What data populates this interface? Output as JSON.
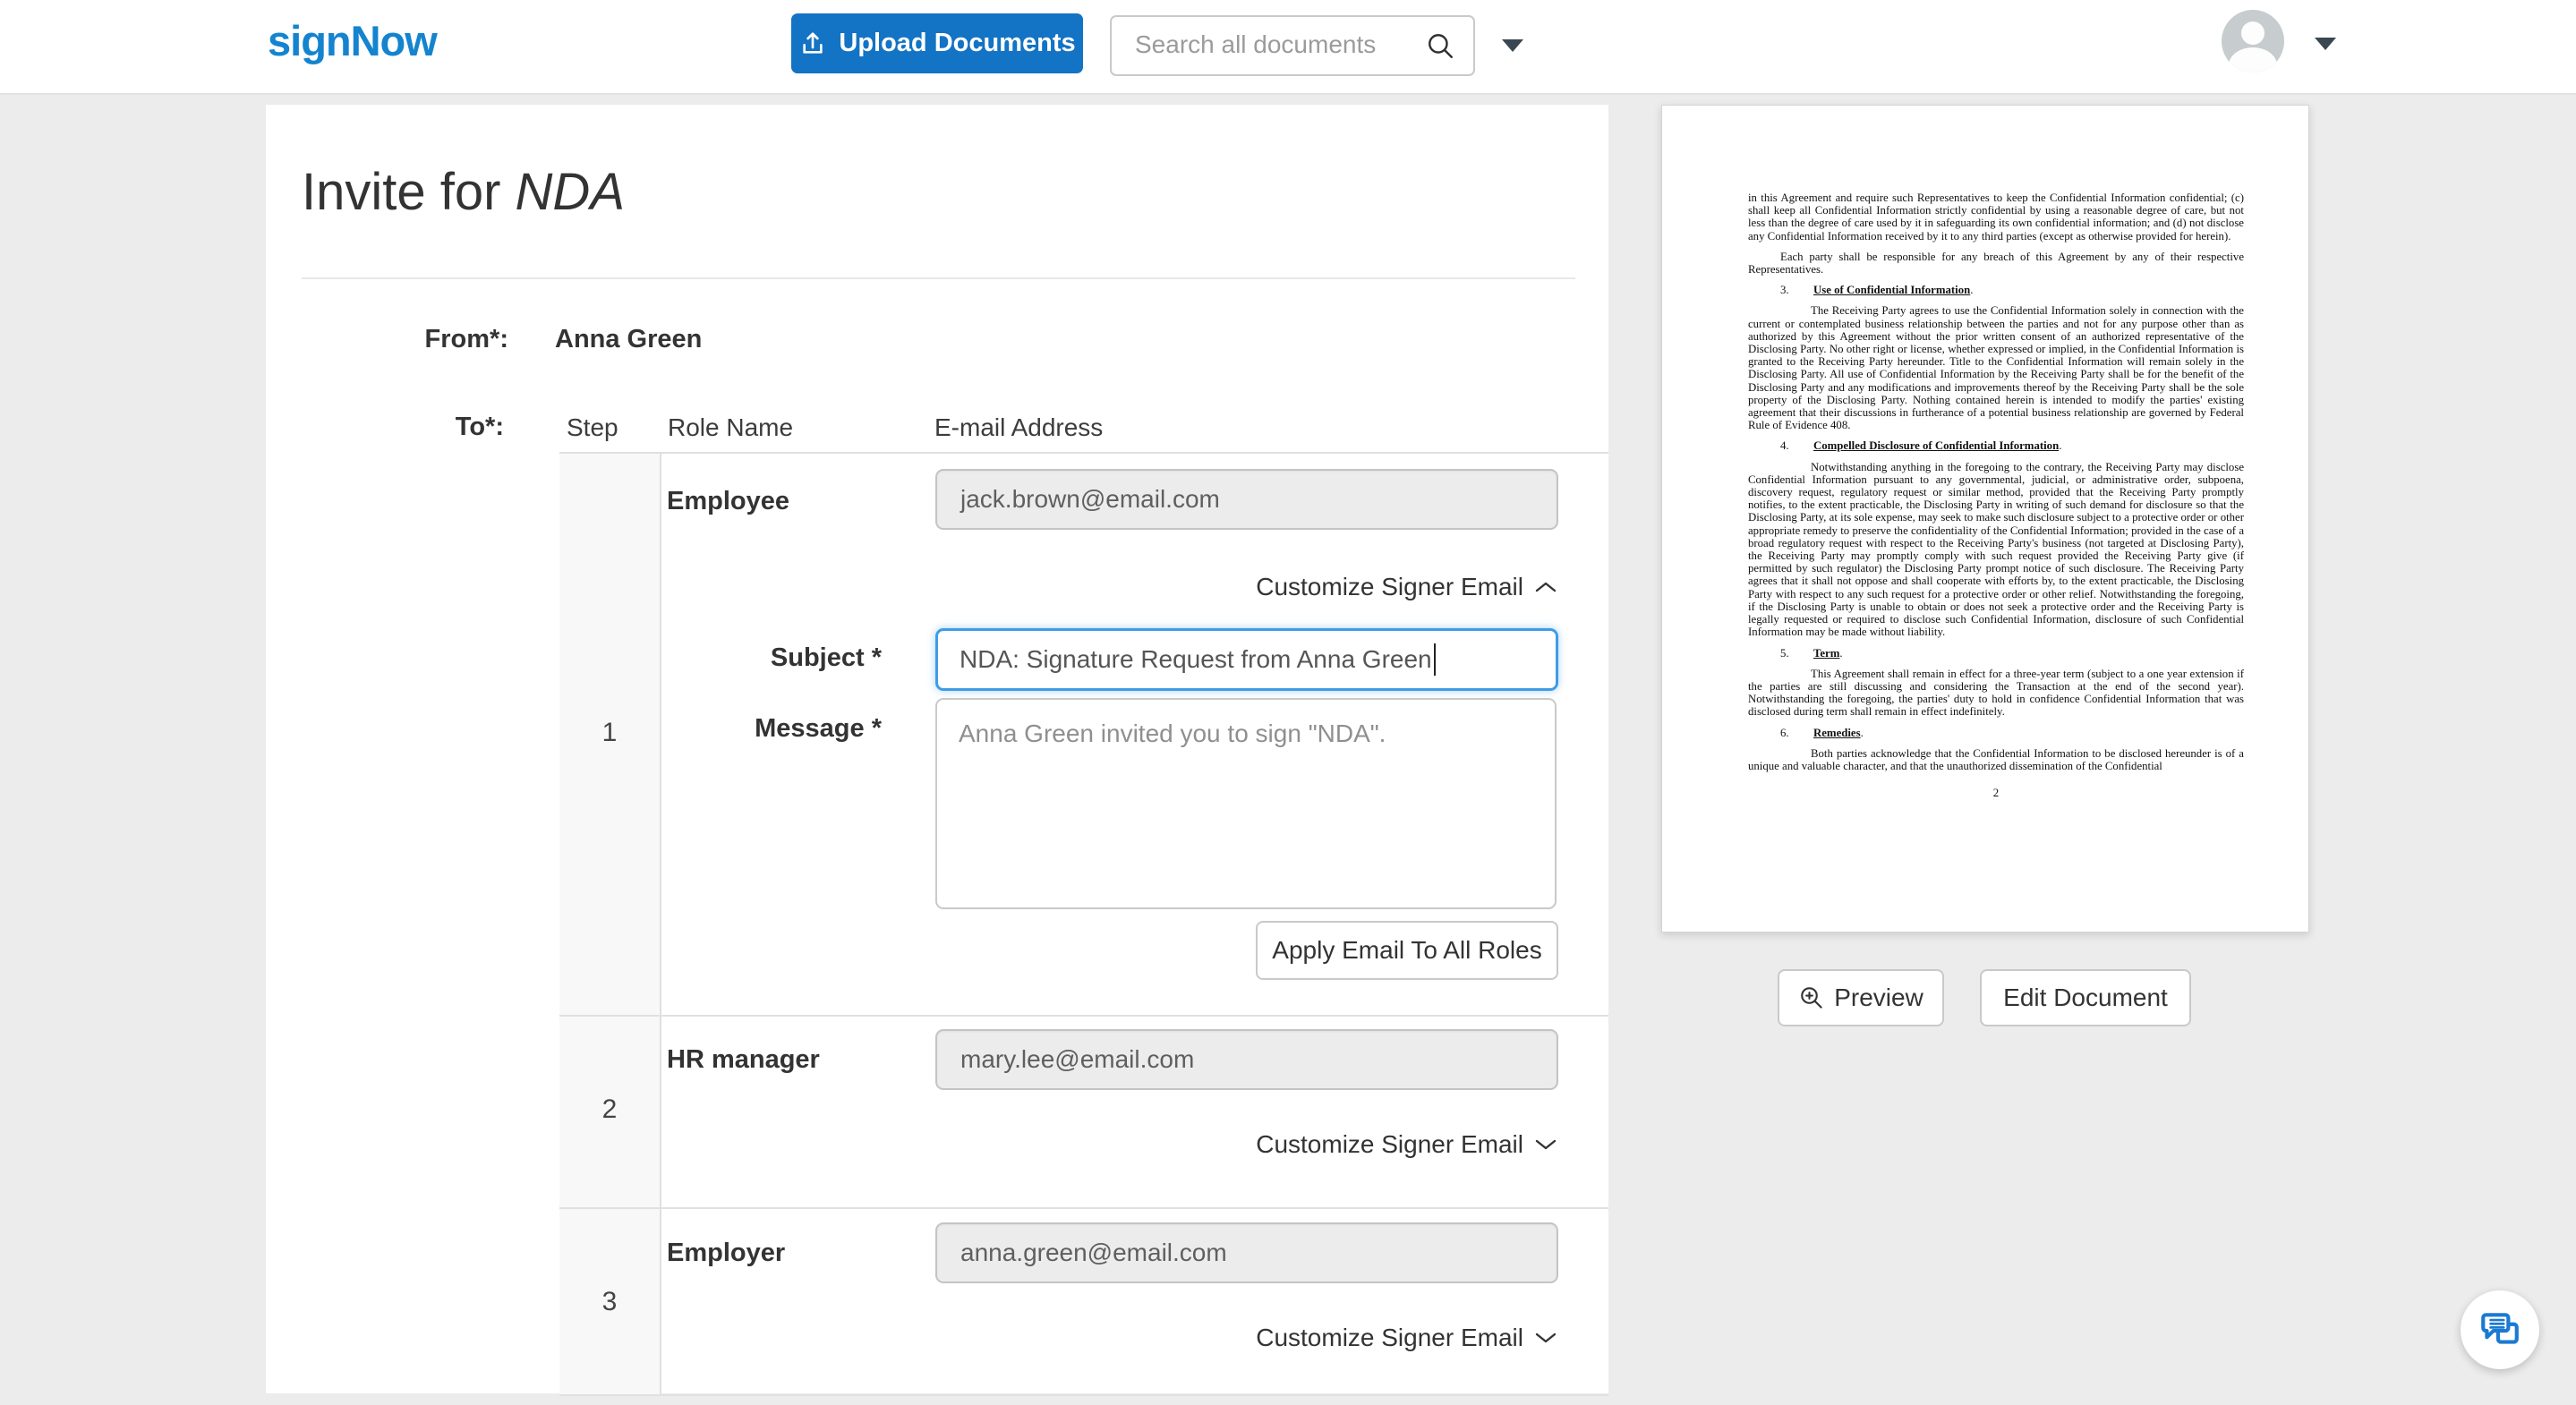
{
  "colors": {
    "brand_blue": "#1484cf",
    "button_blue": "#1373c4",
    "focus_blue": "#3e9ce6",
    "page_background": "#ececec"
  },
  "header": {
    "logo": "signNow",
    "upload_button": "Upload Documents",
    "search_placeholder": "Search all documents"
  },
  "invite": {
    "title_prefix": "Invite for ",
    "title_doc": "NDA",
    "from_label": "From*:",
    "from_value": "Anna Green",
    "to_label": "To*:",
    "columns": {
      "step": "Step",
      "role": "Role Name",
      "email": "E-mail Address"
    },
    "customize_label": "Customize Signer Email",
    "subject_label": "Subject *",
    "message_label": "Message *",
    "subject_value": "NDA: Signature Request from Anna Green",
    "message_value": "Anna Green invited you to sign \"NDA\".",
    "apply_button": "Apply Email To All Roles",
    "rows": [
      {
        "step": "1",
        "role": "Employee",
        "email": "jack.brown@email.com"
      },
      {
        "step": "2",
        "role": "HR manager",
        "email": "mary.lee@email.com"
      },
      {
        "step": "3",
        "role": "Employer",
        "email": "anna.green@email.com"
      }
    ]
  },
  "preview": {
    "preview_button": "Preview",
    "edit_button": "Edit Document",
    "doc": {
      "p1": "in this Agreement and require such Representatives to keep the Confidential Information confidential; (c) shall keep all Confidential Information strictly confidential by using a reasonable degree of care, but not less than the degree of care used by it in safeguarding its own confidential information; and (d) not disclose any Confidential Information received by it to any third parties (except as otherwise provided for herein).",
      "p2": "Each party shall be responsible for any breach of this Agreement by any of their respective Representatives.",
      "h3_num": "3.",
      "h3_title": "Use of Confidential Information",
      "h3_dot": ".",
      "p3": "The Receiving Party agrees to use the Confidential Information solely in connection with the current or contemplated business relationship between the parties and not for any purpose other than as authorized by this Agreement without the prior written consent of an authorized representative of the Disclosing Party.  No other right or license, whether expressed or implied, in the Confidential Information is granted to the Receiving Party hereunder.  Title to the Confidential Information will remain solely in the Disclosing Party.  All use of Confidential Information by the Receiving Party shall be for the benefit of the Disclosing Party and any modifications and improvements thereof by the Receiving Party shall be the sole property of the Disclosing Party.  Nothing contained herein is intended to modify the parties' existing agreement that their discussions in furtherance of a potential business relationship are governed by Federal Rule of Evidence 408.",
      "h4_num": "4.",
      "h4_title": "Compelled Disclosure of Confidential Information",
      "h4_dot": ".",
      "p4": "Notwithstanding anything in the foregoing to the contrary, the Receiving Party may disclose Confidential Information pursuant to any governmental, judicial, or administrative order, subpoena, discovery request, regulatory request or similar method, provided that the Receiving Party promptly notifies, to the extent practicable, the Disclosing Party in writing of such demand for disclosure so that the Disclosing Party, at its sole expense, may seek to make such disclosure subject to a protective order or other appropriate remedy to preserve the confidentiality of the Confidential Information; provided in the case of a broad regulatory request with respect to the Receiving Party's business (not targeted at Disclosing Party), the Receiving Party may promptly comply with such request provided the Receiving Party give (if permitted by such regulator) the Disclosing Party prompt notice of such disclosure.  The Receiving Party agrees that it shall not oppose and shall cooperate with efforts by, to the extent practicable, the Disclosing Party with respect to any such request for a protective order or other relief.  Notwithstanding the foregoing, if the Disclosing Party is unable to obtain or does not seek a protective order and the Receiving Party is legally requested or required to disclose such Confidential Information, disclosure of such Confidential Information may be made without liability.",
      "h5_num": "5.",
      "h5_title": "Term",
      "h5_dot": ".",
      "p5": "This Agreement shall remain in effect for a three-year term (subject to a one year extension if the parties are still discussing and considering the Transaction at the end of the second year).  Notwithstanding the foregoing, the parties' duty to hold in confidence Confidential Information that was disclosed during term shall remain in effect indefinitely.",
      "h6_num": "6.",
      "h6_title": "Remedies",
      "h6_dot": ".",
      "p6": "Both parties acknowledge that the Confidential Information to be disclosed hereunder is of a unique and valuable character, and that the unauthorized dissemination of the Confidential",
      "page_number": "2"
    }
  }
}
